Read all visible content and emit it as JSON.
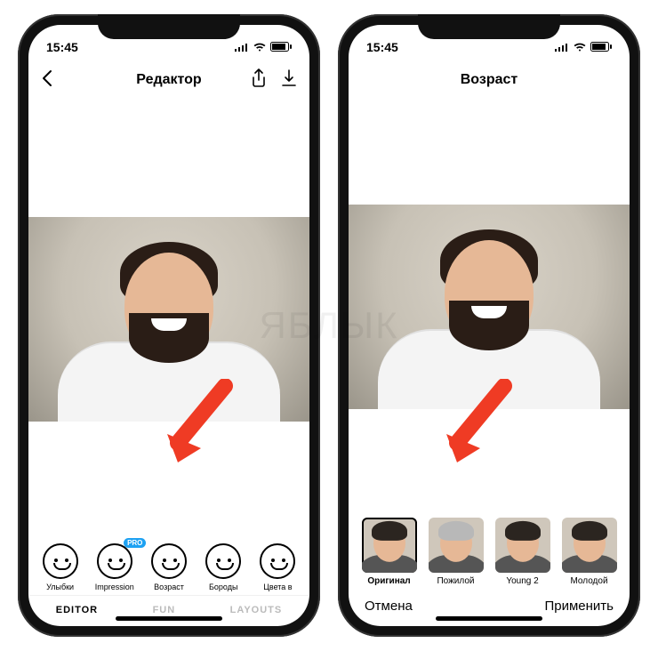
{
  "statusbar": {
    "time": "15:45"
  },
  "left": {
    "title": "Редактор",
    "filters": [
      {
        "label": "Улыбки",
        "pro": false
      },
      {
        "label": "Impression",
        "pro": true
      },
      {
        "label": "Возраст",
        "pro": false
      },
      {
        "label": "Бороды",
        "pro": false
      },
      {
        "label": "Цвета в",
        "pro": false
      }
    ],
    "pro_badge": "PRO",
    "tabs": {
      "editor": "EDITOR",
      "fun": "FUN",
      "layouts": "LAYOUTS",
      "active": "EDITOR"
    }
  },
  "right": {
    "title": "Возраст",
    "thumbs": [
      {
        "label": "Оригинал",
        "selected": true,
        "hair": "dark"
      },
      {
        "label": "Пожилой",
        "selected": false,
        "hair": "gray"
      },
      {
        "label": "Young 2",
        "selected": false,
        "hair": "dark"
      },
      {
        "label": "Молодой",
        "selected": false,
        "hair": "dark"
      }
    ],
    "actions": {
      "cancel": "Отмена",
      "apply": "Применить"
    }
  },
  "watermark": "ЯБЛЫК"
}
